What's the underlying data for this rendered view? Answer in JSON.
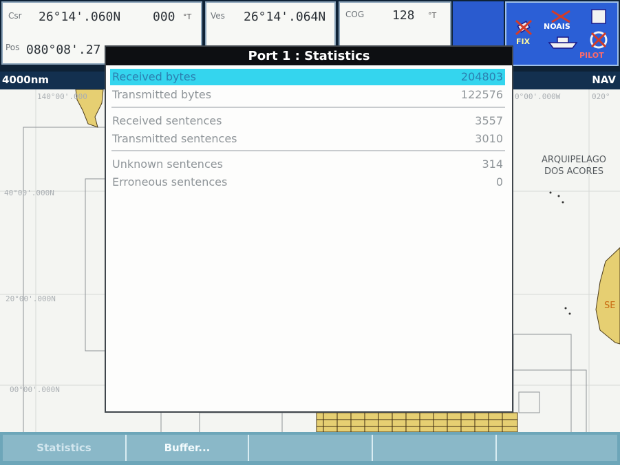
{
  "header": {
    "csr": {
      "label": "Csr",
      "lat": "26°14'.060N",
      "heading": "000",
      "unit": "°T"
    },
    "ves": {
      "label": "Ves",
      "lat": "26°14'.064N"
    },
    "cog": {
      "label": "COG",
      "value": "128",
      "unit": "°T"
    },
    "pos": {
      "label": "Pos",
      "lon": "080°08'.27"
    }
  },
  "icons": {
    "fix": "FIX",
    "noais": "NOAIS",
    "pilot": "PILOT"
  },
  "bar": {
    "scale": "4000nm",
    "mode": "NAV"
  },
  "chart": {
    "coords": [
      "140°00'.000",
      "40°00'.000N",
      "20°00'.000N",
      "00°00'.000N",
      "0°00'.000W",
      "020°"
    ],
    "places": [
      "ARQUIPELAGO",
      "DOS ACORES",
      "SE"
    ]
  },
  "dialog": {
    "title": "Port 1 : Statistics",
    "rows": [
      {
        "label": "Received bytes",
        "value": "204803"
      },
      {
        "label": "Transmitted bytes",
        "value": "122576"
      },
      {
        "label": "Received sentences",
        "value": "3557"
      },
      {
        "label": "Transmitted sentences",
        "value": "3010"
      },
      {
        "label": "Unknown sentences",
        "value": "314"
      },
      {
        "label": "Erroneous sentences",
        "value": "0"
      }
    ]
  },
  "softkeys": [
    "Statistics",
    "Buffer...",
    "",
    "",
    ""
  ],
  "colors": {
    "highlight": "#34d5ee",
    "softkey": "#8ab8c8",
    "title_bg": "#0d0f12"
  }
}
